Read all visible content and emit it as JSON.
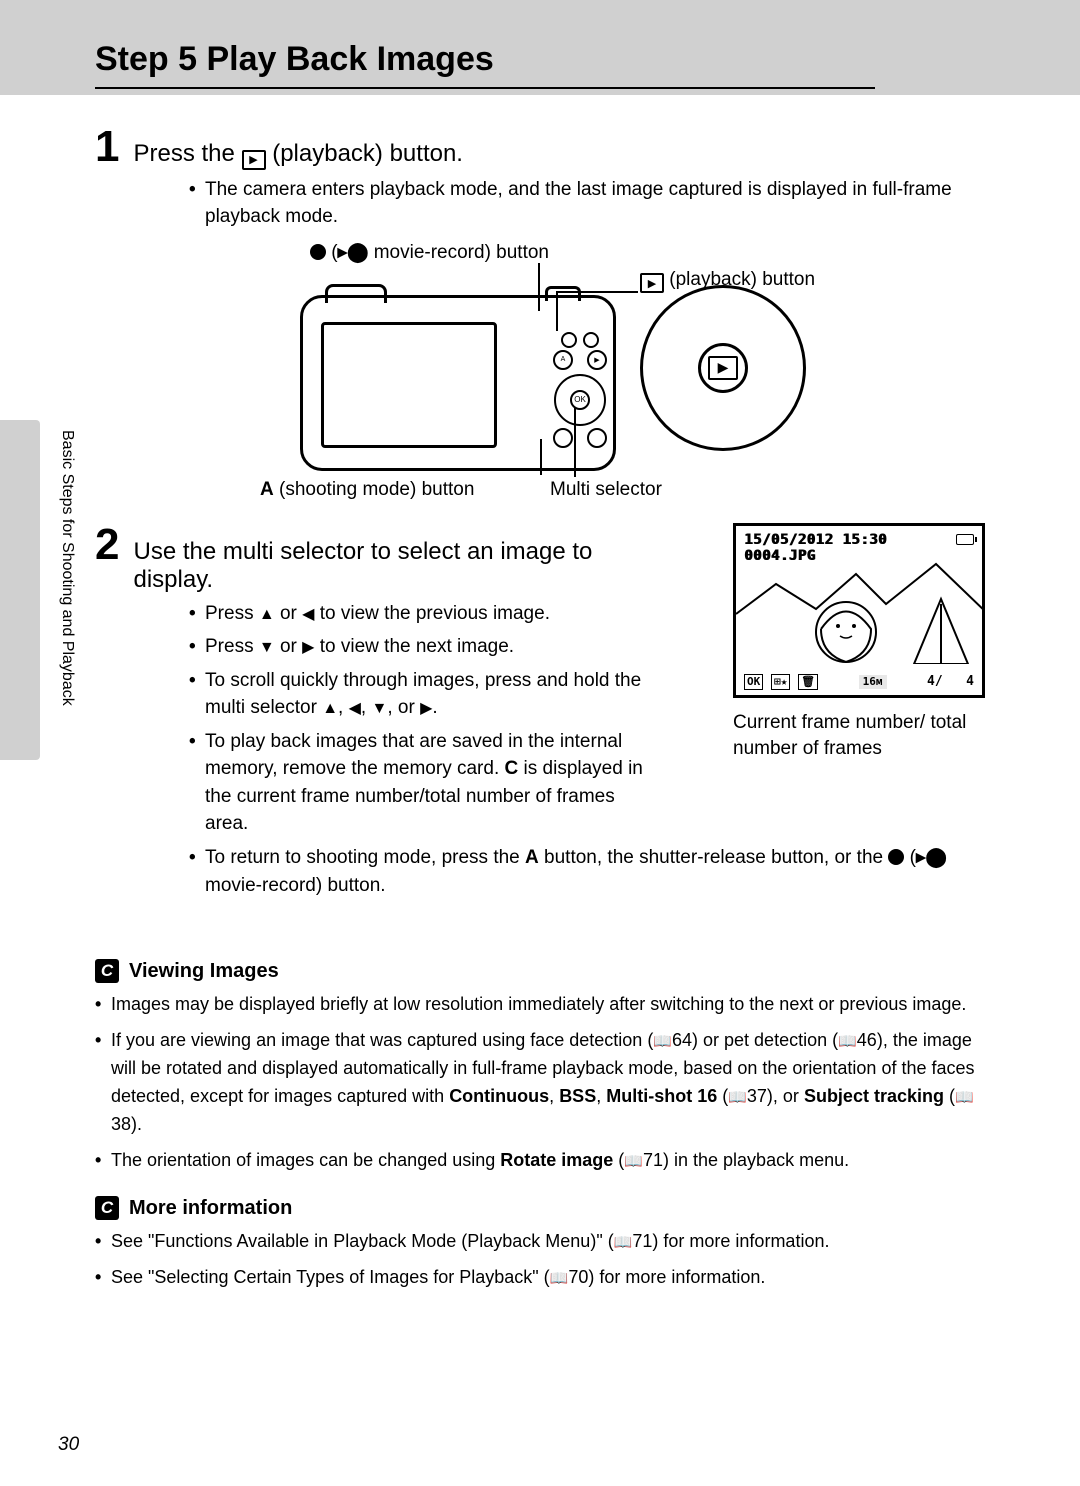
{
  "header": {
    "title": "Step 5 Play Back Images"
  },
  "sidetab": "Basic Steps for Shooting and Playback",
  "step1": {
    "num": "1",
    "title_pre": "Press the ",
    "title_post": " (playback) button.",
    "bullet": "The camera enters playback mode, and the last image captured is displayed in full-frame playback mode."
  },
  "camera_labels": {
    "movie_record_pre": "(",
    "movie_record_post": " movie-record) button",
    "playback": " (playback) button",
    "shooting_mode_pre": "A",
    "shooting_mode_post": "  (shooting mode) button",
    "multi_selector": "Multi selector"
  },
  "step2": {
    "num": "2",
    "title": "Use the multi selector to select an image to display.",
    "b1_pre": "Press ",
    "b1_mid": " or ",
    "b1_post": " to view the previous image.",
    "b2_pre": "Press ",
    "b2_mid": " or ",
    "b2_post": " to view the next image.",
    "b3_pre": "To scroll quickly through images, press and hold the multi selector ",
    "b3_sep": ", ",
    "b3_or": ", or ",
    "b3_end": ".",
    "b4_pre": "To play back images that are saved in the internal memory, remove the memory card. ",
    "b4_c": "C",
    "b4_post": " is displayed in the current frame number/total number of frames area.",
    "b5_pre": "To return to shooting mode, press the ",
    "b5_a": "A",
    "b5_mid": " button, the shutter-release button, or the ",
    "b5_post": " movie-record) button.",
    "b5_paren": " ("
  },
  "screen": {
    "date": "15/05/2012 15:30",
    "filename": "0004.JPG",
    "ok": "OK",
    "count_cur": "4",
    "count_sep": "/",
    "count_total": "4",
    "caption": "Current frame number/ total number of frames"
  },
  "viewing": {
    "title": "Viewing Images",
    "b1": "Images may be displayed briefly at low resolution immediately after switching to the next or previous image.",
    "b2_pre": "If you are viewing an image that was captured using face detection (",
    "b2_ref1": "64) or pet detection (",
    "b2_ref2": "46), the image will be rotated and displayed automatically in full-frame playback mode, based on the orientation of the faces detected, except for images captured with ",
    "b2_bold1": "Continuous",
    "b2_s1": ", ",
    "b2_bold2": "BSS",
    "b2_s2": ", ",
    "b2_bold3": "Multi-shot 16",
    "b2_ref3": " (",
    "b2_ref3b": "37), or ",
    "b2_bold4": "Subject tracking",
    "b2_ref4": " (",
    "b2_ref4b": "38).",
    "b3_pre": "The orientation of images can be changed using ",
    "b3_bold": "Rotate image",
    "b3_post": " (",
    "b3_ref": "71) in the playback menu."
  },
  "more": {
    "title": "More information",
    "b1_pre": "See \"Functions Available in Playback Mode (Playback Menu)\" (",
    "b1_post": "71) for more information.",
    "b2_pre": "See \"Selecting Certain Types of Images for Playback\" (",
    "b2_post": "70) for more information."
  },
  "page_number": "30"
}
